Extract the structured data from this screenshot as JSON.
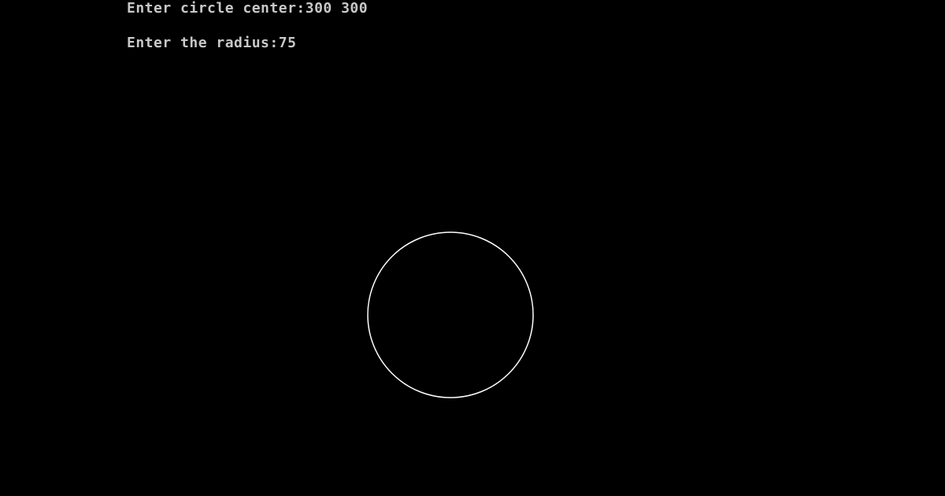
{
  "console": {
    "prompt_center_label": "Enter circle center:",
    "center_value": "300 300",
    "prompt_radius_label": "Enter the radius:",
    "radius_value": "75"
  },
  "colors": {
    "background": "#000000",
    "text": "#c8c8c8",
    "circle_stroke": "#ffffff"
  }
}
